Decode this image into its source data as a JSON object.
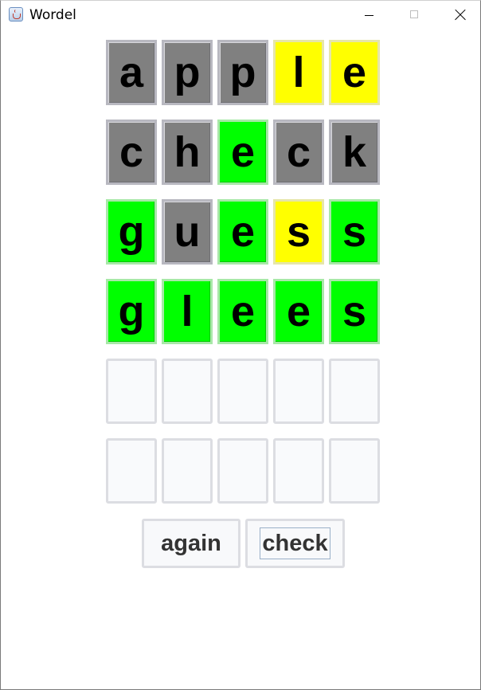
{
  "window": {
    "title": "Wordel",
    "icon": "java-cup-icon"
  },
  "colors": {
    "gray": "#808080",
    "yellow": "#ffff00",
    "green": "#00ff00",
    "empty": "#f9fafc"
  },
  "board": {
    "rows": [
      {
        "letters": [
          "a",
          "p",
          "p",
          "l",
          "e"
        ],
        "states": [
          "gray",
          "gray",
          "gray",
          "yellow",
          "yellow"
        ]
      },
      {
        "letters": [
          "c",
          "h",
          "e",
          "c",
          "k"
        ],
        "states": [
          "gray",
          "gray",
          "green",
          "gray",
          "gray"
        ]
      },
      {
        "letters": [
          "g",
          "u",
          "e",
          "s",
          "s"
        ],
        "states": [
          "green",
          "gray",
          "green",
          "yellow",
          "green"
        ]
      },
      {
        "letters": [
          "g",
          "l",
          "e",
          "e",
          "s"
        ],
        "states": [
          "green",
          "green",
          "green",
          "green",
          "green"
        ]
      },
      {
        "letters": [
          "",
          "",
          "",
          "",
          ""
        ],
        "states": [
          "empty",
          "empty",
          "empty",
          "empty",
          "empty"
        ]
      },
      {
        "letters": [
          "",
          "",
          "",
          "",
          ""
        ],
        "states": [
          "empty",
          "empty",
          "empty",
          "empty",
          "empty"
        ]
      }
    ]
  },
  "buttons": {
    "again_label": "again",
    "check_label": "check"
  }
}
